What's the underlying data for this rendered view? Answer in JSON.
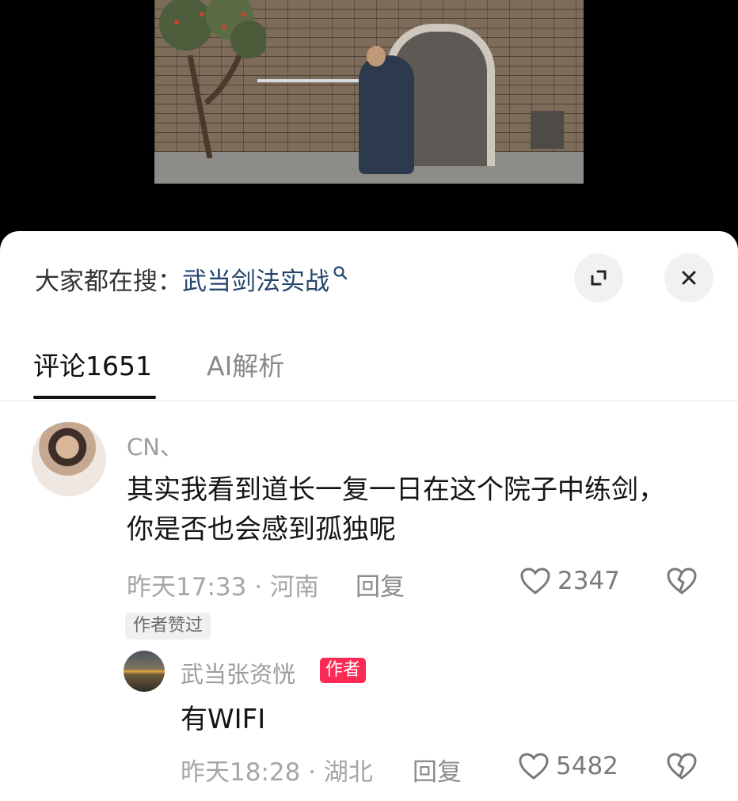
{
  "search_bar": {
    "prefix": "大家都在搜：",
    "query": "武当剑法实战",
    "expand_icon": "expand-icon",
    "close_icon": "close-icon"
  },
  "tabs": [
    {
      "label": "评论1651",
      "active": true
    },
    {
      "label": "AI解析",
      "active": false
    }
  ],
  "comments": [
    {
      "username": "CN、",
      "text": "其实我看到道长一复一日在这个院子中练剑，你是否也会感到孤独呢",
      "time_location": "昨天17:33 · 河南",
      "reply_label": "回复",
      "likes": "2347",
      "badge": "作者赞过",
      "replies": [
        {
          "username": "武当张资恍",
          "author_tag": "作者",
          "text": "有WIFI",
          "time_location": "昨天18:28 · 湖北",
          "reply_label": "回复",
          "likes": "5482"
        }
      ]
    }
  ],
  "colors": {
    "query_text": "#24466e",
    "author_tag_bg": "#fc2a55",
    "tab_active": "#111111",
    "tab_inactive": "#8a8a8a"
  }
}
